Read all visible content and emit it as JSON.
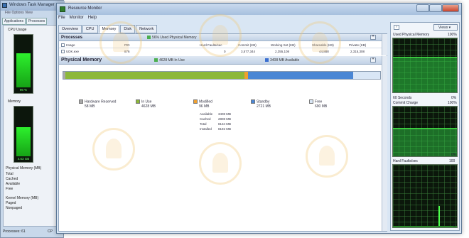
{
  "taskmgr": {
    "title": "Windows Task Manager",
    "menu": "File  Options  View",
    "tabs": [
      "Applications",
      "Processes"
    ],
    "cpu_usage_label": "CPU Usage",
    "cpu_value": "96 %",
    "memory_label": "Memory",
    "memory_value": "4.63 GB",
    "physical_memory_label": "Physical Memory (MB)",
    "stats": [
      "Total",
      "Cached",
      "Available",
      "Free"
    ],
    "kernel_memory_label": "Kernel Memory (MB)",
    "kernel_stats": [
      "Paged",
      "Nonpaged"
    ],
    "status_processes": "Processes: 61",
    "status_cpu": "CP",
    "cpu_level": 0.96,
    "memory_level": 0.6
  },
  "resmon": {
    "title": "Resource Monitor",
    "menu": [
      "File",
      "Monitor",
      "Help"
    ],
    "tabs": [
      "Overview",
      "CPU",
      "Memory",
      "Disk",
      "Network"
    ],
    "active_tab": "Memory",
    "processes": {
      "header": "Processes",
      "info": "56% Used Physical Memory",
      "columns": [
        "Image",
        "PID",
        "Hard Faults/sec",
        "Commit (KB)",
        "Working Set (KB)",
        "Shareable (KB)",
        "Private (KB)"
      ],
      "rows": [
        [
          "UDK.exe",
          "876",
          "0",
          "3,577,344",
          "2,355,108",
          "44,888",
          "2,315,308"
        ]
      ]
    },
    "physical_memory": {
      "header": "Physical Memory",
      "in_use_info": "4628 MB In Use",
      "available_info": "3408 MB Available",
      "bar_fractions": {
        "hardware_reserved": 0.007,
        "in_use": 0.565,
        "modified": 0.012,
        "standby": 0.331,
        "free": 0.085
      },
      "legend": [
        {
          "name": "Hardware Reserved",
          "value": "58 MB",
          "color": "#a9a9a9"
        },
        {
          "name": "In Use",
          "value": "4628 MB",
          "color": "#8cb83a"
        },
        {
          "name": "Modified",
          "value": "96 MB",
          "color": "#f0a030"
        },
        {
          "name": "Standby",
          "value": "2721 MB",
          "color": "#4a86d4"
        },
        {
          "name": "Free",
          "value": "690 MB",
          "color": "#d9e6f5"
        }
      ],
      "stats": [
        {
          "label": "Available",
          "value": "3408 MB"
        },
        {
          "label": "Cached",
          "value": "2808 MB"
        },
        {
          "label": "Total",
          "value": "8134 MB"
        },
        {
          "label": "Installed",
          "value": "8192 MB"
        }
      ]
    },
    "graphs": {
      "views_label": "Views",
      "used_physical": {
        "label": "Used Physical Memory",
        "value": "100%"
      },
      "time_label": "60 Seconds",
      "time_value": "0%",
      "commit": {
        "label": "Commit Charge",
        "value": "100%"
      },
      "commit_low": "0%",
      "hard_faults": {
        "label": "Hard Faults/sec",
        "value": "100"
      },
      "hf_low": "0"
    }
  }
}
